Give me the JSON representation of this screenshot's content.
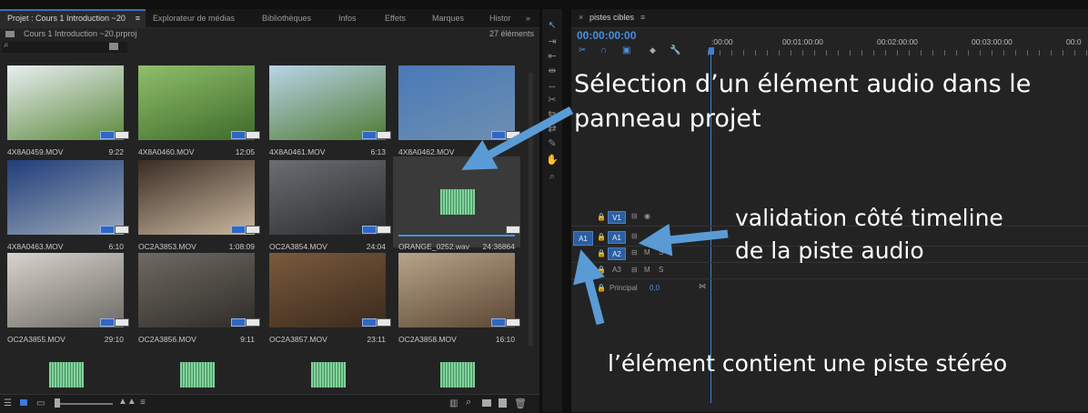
{
  "project_panel": {
    "tabs": [
      "Projet : Cours 1 Introduction ~20",
      "Explorateur de médias",
      "Bibliothèques",
      "Infos",
      "Effets",
      "Marques",
      "Histor"
    ],
    "tab_menu_icon": "panel-menu-icon",
    "overflow_icon": "double-chevron-right-icon",
    "project_file": "Cours 1 Introduction ~20.prproj",
    "item_count": "27 éléments",
    "items": [
      {
        "name": "4X8A0459.MOV",
        "duration": "9:22",
        "kind": "video"
      },
      {
        "name": "4X8A0460.MOV",
        "duration": "12:05",
        "kind": "video"
      },
      {
        "name": "4X8A0461.MOV",
        "duration": "6:13",
        "kind": "video"
      },
      {
        "name": "4X8A0462.MOV",
        "duration": "",
        "kind": "video"
      },
      {
        "name": "4X8A0463.MOV",
        "duration": "6:10",
        "kind": "video"
      },
      {
        "name": "OC2A3853.MOV",
        "duration": "1:08:09",
        "kind": "video"
      },
      {
        "name": "OC2A3854.MOV",
        "duration": "24:04",
        "kind": "video"
      },
      {
        "name": "ORANGE_0252.wav",
        "duration": "24:36864",
        "kind": "audio"
      },
      {
        "name": "OC2A3855.MOV",
        "duration": "29:10",
        "kind": "video"
      },
      {
        "name": "OC2A3856.MOV",
        "duration": "9:11",
        "kind": "video"
      },
      {
        "name": "OC2A3857.MOV",
        "duration": "23:11",
        "kind": "video"
      },
      {
        "name": "OC2A3858.MOV",
        "duration": "16:10",
        "kind": "video"
      },
      {
        "name": "",
        "duration": "",
        "kind": "audio"
      },
      {
        "name": "",
        "duration": "",
        "kind": "audio"
      },
      {
        "name": "",
        "duration": "",
        "kind": "audio"
      },
      {
        "name": "",
        "duration": "",
        "kind": "audio"
      }
    ]
  },
  "timeline": {
    "sequence_name": "pistes cibles",
    "timecode": "00:00:00:00",
    "ruler": [
      ":00:00",
      "00:01:00:00",
      "00:02:00:00",
      "00:03:00:00",
      "00:0"
    ],
    "tracks": {
      "v1": "V1",
      "a1_source": "A1",
      "a1": "A1",
      "a2": "A2",
      "a3": "A3",
      "m": "M",
      "s": "S",
      "master_label": "Principal",
      "master_value": "0,0"
    }
  },
  "annotations": {
    "selection_line1": "Sélection d’un élément audio dans le",
    "selection_line2": "panneau projet",
    "validation_line1": "validation côté timeline",
    "validation_line2": "de la piste audio",
    "stereo": "l’élément contient une piste stéréo"
  },
  "colors": {
    "arrow": "#5b9bd5",
    "target_blue": "#2b5fa0",
    "timecode": "#4a8fe0",
    "playhead": "#3d7fd8",
    "wave": "#7fd49a"
  }
}
